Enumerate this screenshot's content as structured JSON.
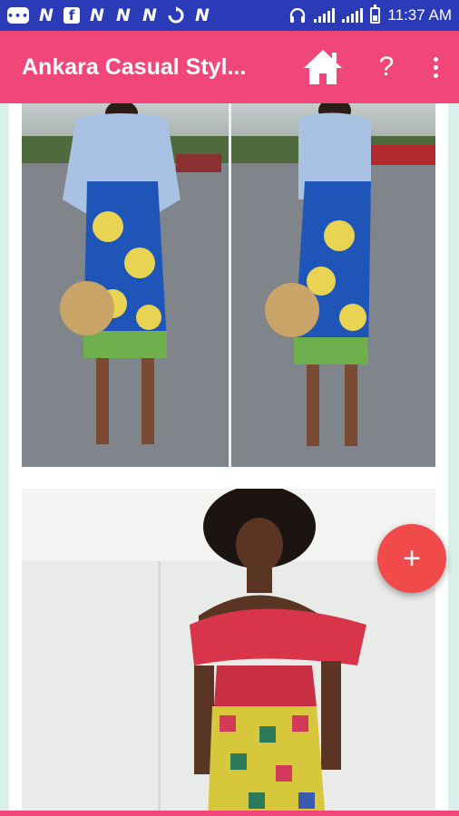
{
  "status_bar": {
    "time": "11:37 AM",
    "left_icons": [
      "chat-icon",
      "n-icon",
      "facebook-icon",
      "n-icon",
      "n-icon",
      "n-icon",
      "sync-icon",
      "n-icon"
    ],
    "right_icons": [
      "headphones-icon",
      "signal-icon",
      "signal-icon",
      "battery-icon"
    ]
  },
  "app_bar": {
    "title": "Ankara Casual Styl...",
    "home_icon": "home-icon",
    "help_label": "?",
    "more_icon": "more-vert-icon"
  },
  "fab": {
    "label": "+"
  },
  "colors": {
    "status_bar": "#2b3bb8",
    "app_bar": "#f0467a",
    "fab": "#f04a4a",
    "background": "#d9efe9"
  }
}
